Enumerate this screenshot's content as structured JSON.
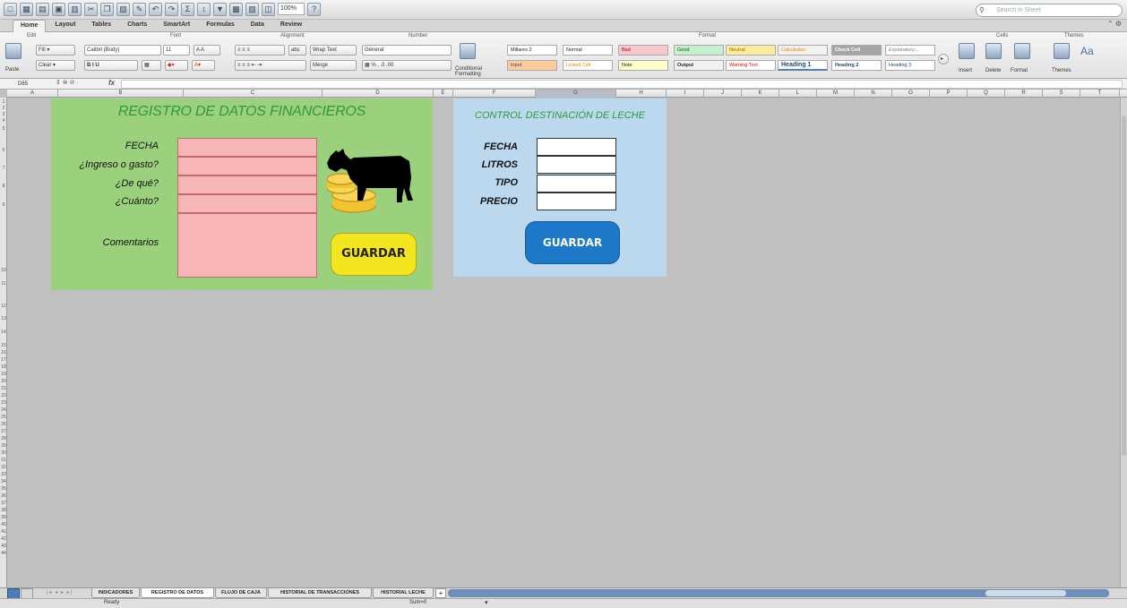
{
  "toolbar": {
    "zoom": "100%",
    "search_placeholder": "Search in Sheet"
  },
  "ribbon_tabs": [
    {
      "label": "Home",
      "active": true
    },
    {
      "label": "Layout"
    },
    {
      "label": "Tables"
    },
    {
      "label": "Charts"
    },
    {
      "label": "SmartArt"
    },
    {
      "label": "Formulas"
    },
    {
      "label": "Data"
    },
    {
      "label": "Review"
    }
  ],
  "ribbon": {
    "groups": {
      "edit": "Edit",
      "font": "Font",
      "alignment": "Alignment",
      "number": "Number",
      "format": "Format",
      "cells": "Cells",
      "themes": "Themes"
    },
    "paste": "Paste",
    "fill": "Fill",
    "clear": "Clear",
    "font_name": "Calibri (Body)",
    "font_size": "11",
    "wrap_text": "Wrap Text",
    "merge": "Merge",
    "number_format": "General",
    "conditional_formatting": "Conditional Formatting",
    "styles": [
      "Millares 2",
      "Normal",
      "Bad",
      "Good",
      "Neutral",
      "Calculation",
      "Check Cell",
      "Explanatory...",
      "Input",
      "Linked Cell",
      "Note",
      "Output",
      "Warning Text",
      "Heading 1",
      "Heading 2",
      "Heading 3"
    ],
    "insert": "Insert",
    "delete": "Delete",
    "format_btn": "Format",
    "themes": "Themes"
  },
  "formula_bar": {
    "name_box": "D65",
    "fx": "fx"
  },
  "columns": [
    "A",
    "B",
    "C",
    "D",
    "E",
    "F",
    "G",
    "H",
    "I",
    "J",
    "K",
    "L",
    "M",
    "N",
    "O",
    "P",
    "Q",
    "R",
    "S",
    "T"
  ],
  "rows": [
    "1",
    "2",
    "3",
    "4",
    "5",
    "6",
    "7",
    "8",
    "9",
    "10",
    "11",
    "12",
    "13",
    "14",
    "15",
    "16",
    "17",
    "18",
    "19",
    "20",
    "21",
    "22",
    "23",
    "24",
    "25",
    "26",
    "27",
    "28",
    "29",
    "30",
    "31",
    "32",
    "33",
    "34",
    "35",
    "36",
    "37",
    "38",
    "39",
    "40",
    "41",
    "42",
    "43",
    "44"
  ],
  "financial_form": {
    "title": "REGISTRO DE DATOS FINANCIEROS",
    "labels": {
      "fecha": "FECHA",
      "ingreso": "¿Ingreso o gasto?",
      "deque": "¿De qué?",
      "cuanto": "¿Cuánto?",
      "comentarios": "Comentarios"
    },
    "save_button": "GUARDAR",
    "colors": {
      "panel": "#9bd07c",
      "cells": "#f7b5b5",
      "button": "#f4e61e",
      "title": "#2f9a3b"
    }
  },
  "milk_form": {
    "title": "CONTROL DESTINACIÓN DE LECHE",
    "labels": {
      "fecha": "FECHA",
      "litros": "LITROS",
      "tipo": "TIPO",
      "precio": "PRECIO"
    },
    "save_button": "GUARDAR",
    "colors": {
      "panel": "#bcd8ee",
      "button": "#1e78c8"
    }
  },
  "sheet_tabs": [
    {
      "label": "INDICADORES"
    },
    {
      "label": "REGISTRO DE DATOS",
      "active": true
    },
    {
      "label": "FLUJO DE CAJA"
    },
    {
      "label": "HISTORIAL DE TRANSACCIONES"
    },
    {
      "label": "HISTORIAL LECHE"
    }
  ],
  "status_bar": {
    "mode": "Ready",
    "sum": "Sum=0"
  },
  "icons": [
    "cow-icon",
    "coins-icon",
    "search-icon",
    "paste-icon",
    "insert-icon",
    "delete-icon",
    "format-icon",
    "themes-icon"
  ]
}
